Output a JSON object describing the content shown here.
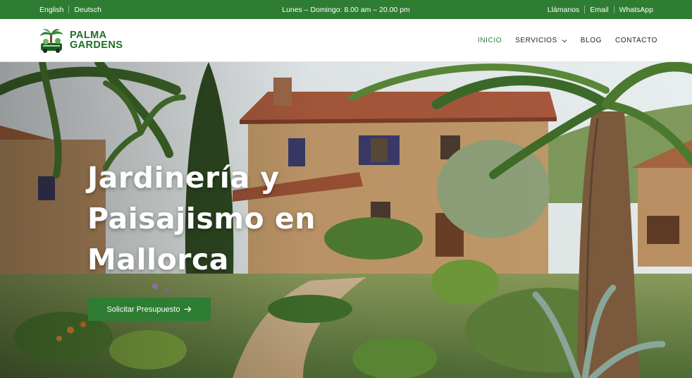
{
  "topbar": {
    "lang_en": "English",
    "lang_de": "Deutsch",
    "hours": "Lunes – Domingo: 8.00 am – 20.00 pm",
    "call": "Llámanos",
    "email": "Email",
    "whatsapp": "WhatsApp",
    "bg_color": "#2e7d32"
  },
  "header": {
    "logo_line1": "PALMA",
    "logo_line2": "GARDENS",
    "nav": {
      "inicio": "INICIO",
      "servicios": "SERVICIOS",
      "blog": "BLOG",
      "contacto": "CONTACTO"
    },
    "accent_color": "#2e7d32"
  },
  "hero": {
    "title_line1": "Jardinería y",
    "title_line2": "Paisajismo en",
    "title_line3": "Mallorca",
    "cta_label": "Solicitar Presupuesto",
    "cta_icon": "arrow-right-icon"
  }
}
